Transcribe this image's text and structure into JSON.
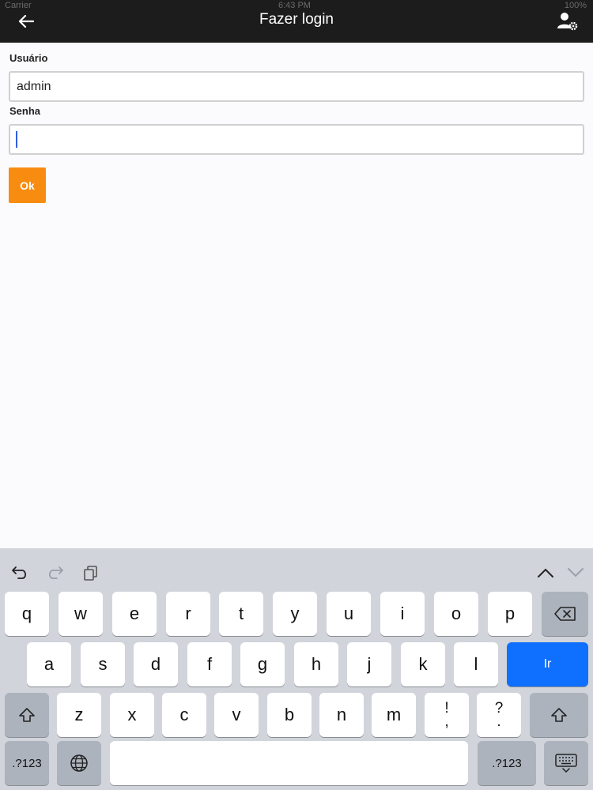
{
  "status_bar": {
    "carrier": "Carrier",
    "time": "6:43 PM",
    "battery": "100%"
  },
  "header": {
    "title": "Fazer login",
    "back_icon": "back-arrow-icon",
    "settings_icon": "user-settings-icon"
  },
  "form": {
    "username_label": "Usuário",
    "username_value": "admin",
    "password_label": "Senha",
    "password_value": "",
    "ok_label": "Ok"
  },
  "keyboard": {
    "row1": [
      "q",
      "w",
      "e",
      "r",
      "t",
      "y",
      "u",
      "i",
      "o",
      "p"
    ],
    "row2": [
      "a",
      "s",
      "d",
      "f",
      "g",
      "h",
      "j",
      "k",
      "l"
    ],
    "row3": [
      "z",
      "x",
      "c",
      "v",
      "b",
      "n",
      "m"
    ],
    "punct1_top": "!",
    "punct1_bottom": ",",
    "punct2_top": "?",
    "punct2_bottom": ".",
    "go_label": "Ir",
    "numbers_label": ".?123",
    "accent_color": "#0f6fff"
  },
  "colors": {
    "header_bg": "#1c1c1c",
    "ok_button": "#f88c11"
  }
}
